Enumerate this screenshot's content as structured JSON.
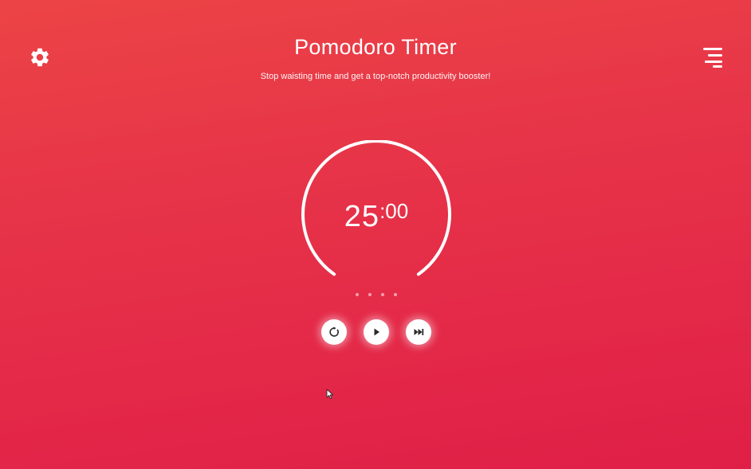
{
  "header": {
    "title": "Pomodoro Timer",
    "subtitle": "Stop waisting time and get a top-notch productivity booster!",
    "settings_icon": "gear-icon",
    "menu_icon": "menu-icon"
  },
  "timer": {
    "minutes": "25",
    "separator": ":",
    "seconds": "00"
  },
  "sessions": {
    "count": 4,
    "completed": 0
  },
  "controls": {
    "reset_icon": "reset-icon",
    "play_icon": "play-icon",
    "skip_icon": "skip-icon"
  },
  "colors": {
    "background_top": "#ec4446",
    "background_bottom": "#e01f47",
    "foreground": "#ffffff",
    "icon_dark": "#2a2a2a"
  }
}
